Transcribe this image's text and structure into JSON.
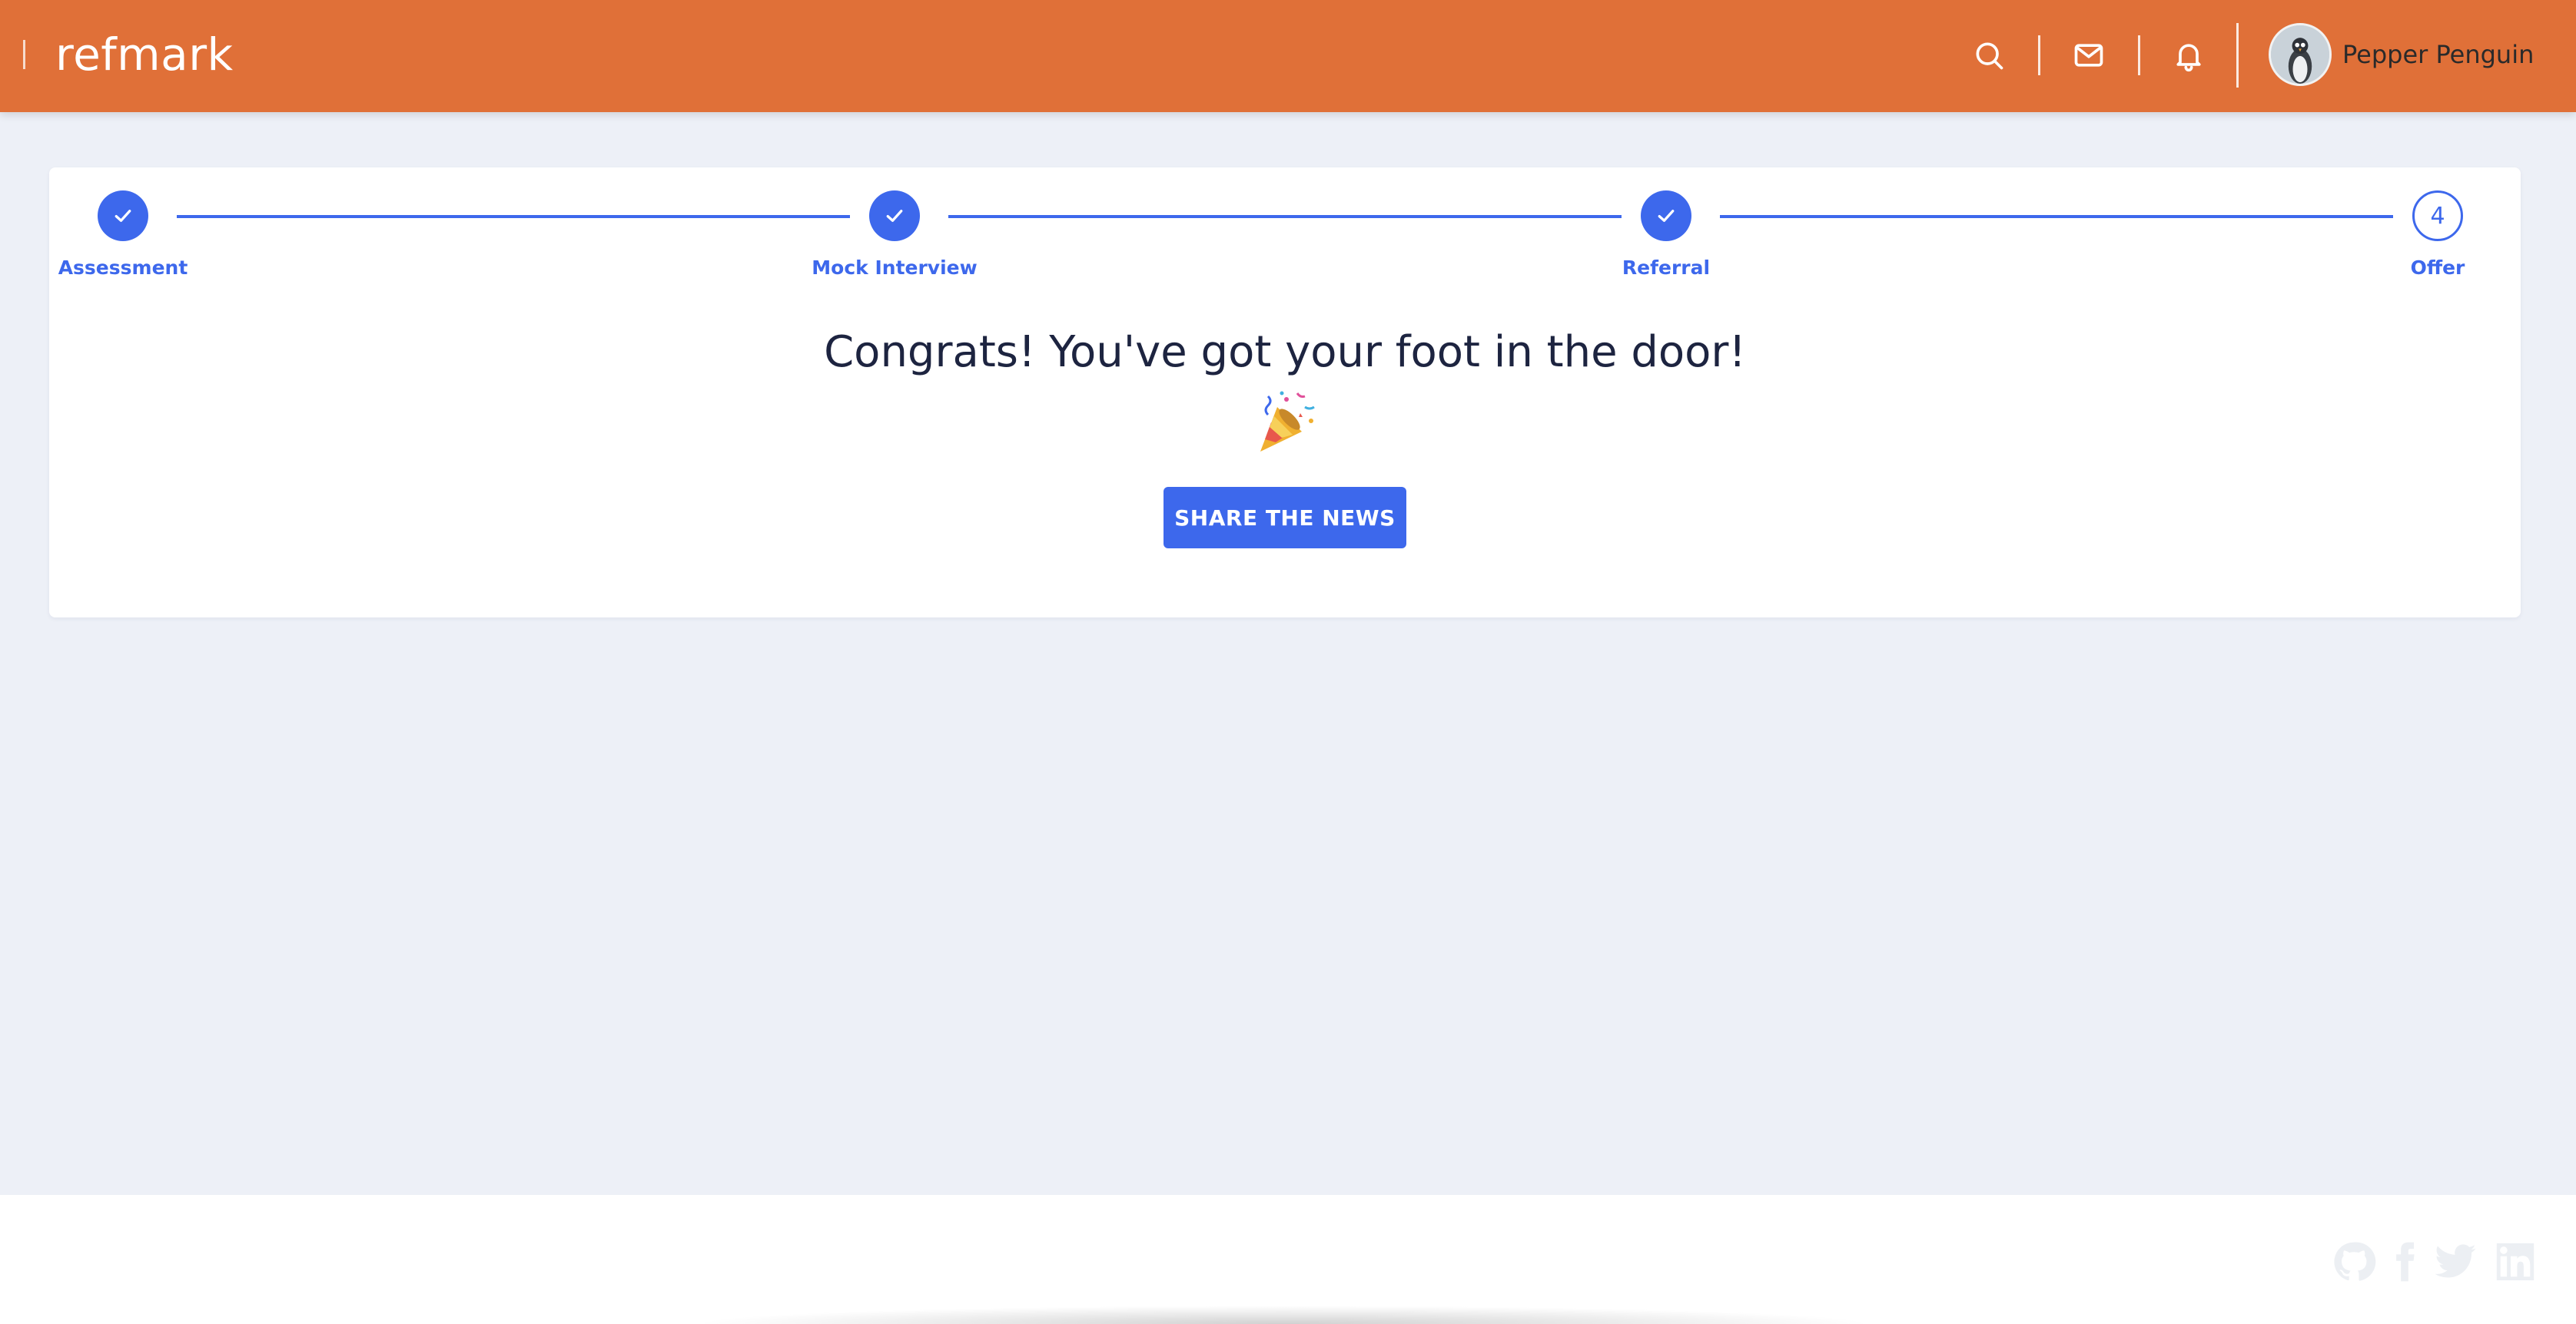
{
  "header": {
    "brand": "refmark",
    "user_name": "Pepper Penguin",
    "icons": [
      "search-icon",
      "mail-icon",
      "bell-icon"
    ],
    "background_color": "#e07038"
  },
  "progress": {
    "steps": [
      {
        "label": "Assessment",
        "state": "complete"
      },
      {
        "label": "Mock Interview",
        "state": "complete"
      },
      {
        "label": "Referral",
        "state": "complete"
      },
      {
        "label": "Offer",
        "state": "current",
        "number": "4"
      }
    ],
    "accent_color": "#3d68ec"
  },
  "main": {
    "headline": "Congrats! You've got your foot in the door!",
    "emoji": "party-popper",
    "share_button": "SHARE THE NEWS"
  },
  "footer": {
    "social_icons": [
      "github-icon",
      "facebook-icon",
      "twitter-icon",
      "linkedin-icon"
    ]
  }
}
